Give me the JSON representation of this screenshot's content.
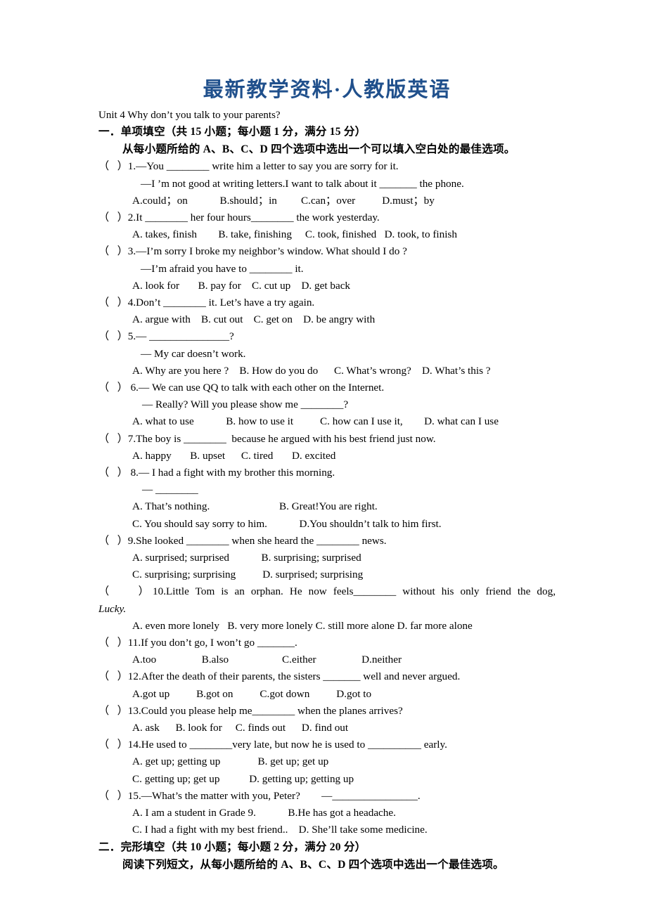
{
  "document": {
    "banner_title": "最新教学资料·人教版英语",
    "banner_color": "#20508C",
    "unit_line": "Unit 4 Why don’t you talk to your parents?"
  },
  "section_one": {
    "heading": "一．单项填空（共 15 小题；每小题 1 分，满分 15 分）",
    "instruction": "从每小题所给的 A、B、C、D 四个选项中选出一个可以填入空白处的最佳选项。",
    "questions": [
      {
        "marker": "（   ）1.",
        "stem_a": "—You ________ write him a letter to say you are sorry for it.",
        "stem_b": "—I ’m not good at writing letters.I want to talk about it _______ the phone.",
        "options_line1": "A.could；on            B.should；in         C.can；over          D.must；by"
      },
      {
        "marker": "（   ）2.",
        "stem_a": "It ________ her four hours________ the work yesterday.",
        "options_line1": "A. takes, finish        B. take, finishing     C. took, finished   D. took, to finish"
      },
      {
        "marker": "（   ）3.",
        "stem_a": "—I’m sorry I broke my neighbor’s window. What should I do ?",
        "stem_b": "—I’m afraid you have to ________ it.",
        "options_line1": "A. look for       B. pay for    C. cut up    D. get back"
      },
      {
        "marker": "（   ）4.",
        "stem_a": "Don’t ________ it. Let’s have a try again.",
        "options_line1": "A. argue with    B. cut out    C. get on    D. be angry with"
      },
      {
        "marker": "（   ）5.",
        "stem_a": "— _______________?",
        "stem_b": "— My car doesn’t work.",
        "options_line1": "A. Why are you here ?    B. How do you do      C. What’s wrong?    D. What’s this ?"
      },
      {
        "marker": "（   ） 6.",
        "stem_a": "— We can use QQ to talk with each other on the Internet.",
        "stem_b": "— Really? Will you please show me ________?",
        "options_line1": "A. what to use            B. how to use it          C. how can I use it,        D. what can I use"
      },
      {
        "marker": "（   ）7.",
        "stem_a": "The boy is ________  because he argued with his best friend just now.",
        "options_line1": "A. happy       B. upset      C. tired       D. excited"
      },
      {
        "marker": "（   ） 8.",
        "stem_a": "— I had a fight with my brother this morning.",
        "stem_b": "— ________",
        "options_line1": "A. That’s nothing.                          B. Great!You are right.",
        "options_line2": "C. You should say sorry to him.            D.You shouldn’t talk to him first."
      },
      {
        "marker": "（   ）9.",
        "stem_a": "She looked ________ when she heard the ________ news.",
        "options_line1": "A. surprised; surprised            B. surprising; surprised",
        "options_line2": "C. surprising; surprising          D. surprised; surprising"
      },
      {
        "marker": "（    ）10.",
        "stem_a": "Little Tom is an orphan. He now feels________ without his only friend the dog,",
        "stem_b_italic": "Lucky.",
        "options_line1": "A. even more lonely   B. very more lonely C. still more alone D. far more alone"
      },
      {
        "marker": "（   ）11.",
        "stem_a": "If you don’t go, I won’t go _______.",
        "options_line1": "A.too                 B.also                    C.either                 D.neither"
      },
      {
        "marker": "（   ）12.",
        "stem_a": "After the death of their parents, the sisters _______ well and never argued.",
        "options_line1": "A.got up          B.got on          C.got down          D.got to"
      },
      {
        "marker": "（   ）13.",
        "stem_a": "Could you please help me________ when the planes arrives?",
        "options_line1": "A. ask      B. look for     C. finds out      D. find out"
      },
      {
        "marker": "（   ）14.",
        "stem_a": "He used to ________very late, but now he is used to __________ early.",
        "options_line1": "A. get up; getting up              B. get up; get up",
        "options_line2": "C. getting up; get up           D. getting up; getting up"
      },
      {
        "marker": "（   ）15.",
        "stem_a": "—What’s the matter with you, Peter?        —________________.",
        "options_line1": "A. I am a student in Grade 9.            B.He has got a headache.",
        "options_line2": "C. I had a fight with my best friend..    D. She’ll take some medicine."
      }
    ]
  },
  "section_two": {
    "heading": "二．完形填空（共 10 小题；每小题 2 分，满分 20 分）",
    "instruction": "阅读下列短文，从每小题所给的 A、B、C、D 四个选项中选出一个最佳选项。"
  }
}
